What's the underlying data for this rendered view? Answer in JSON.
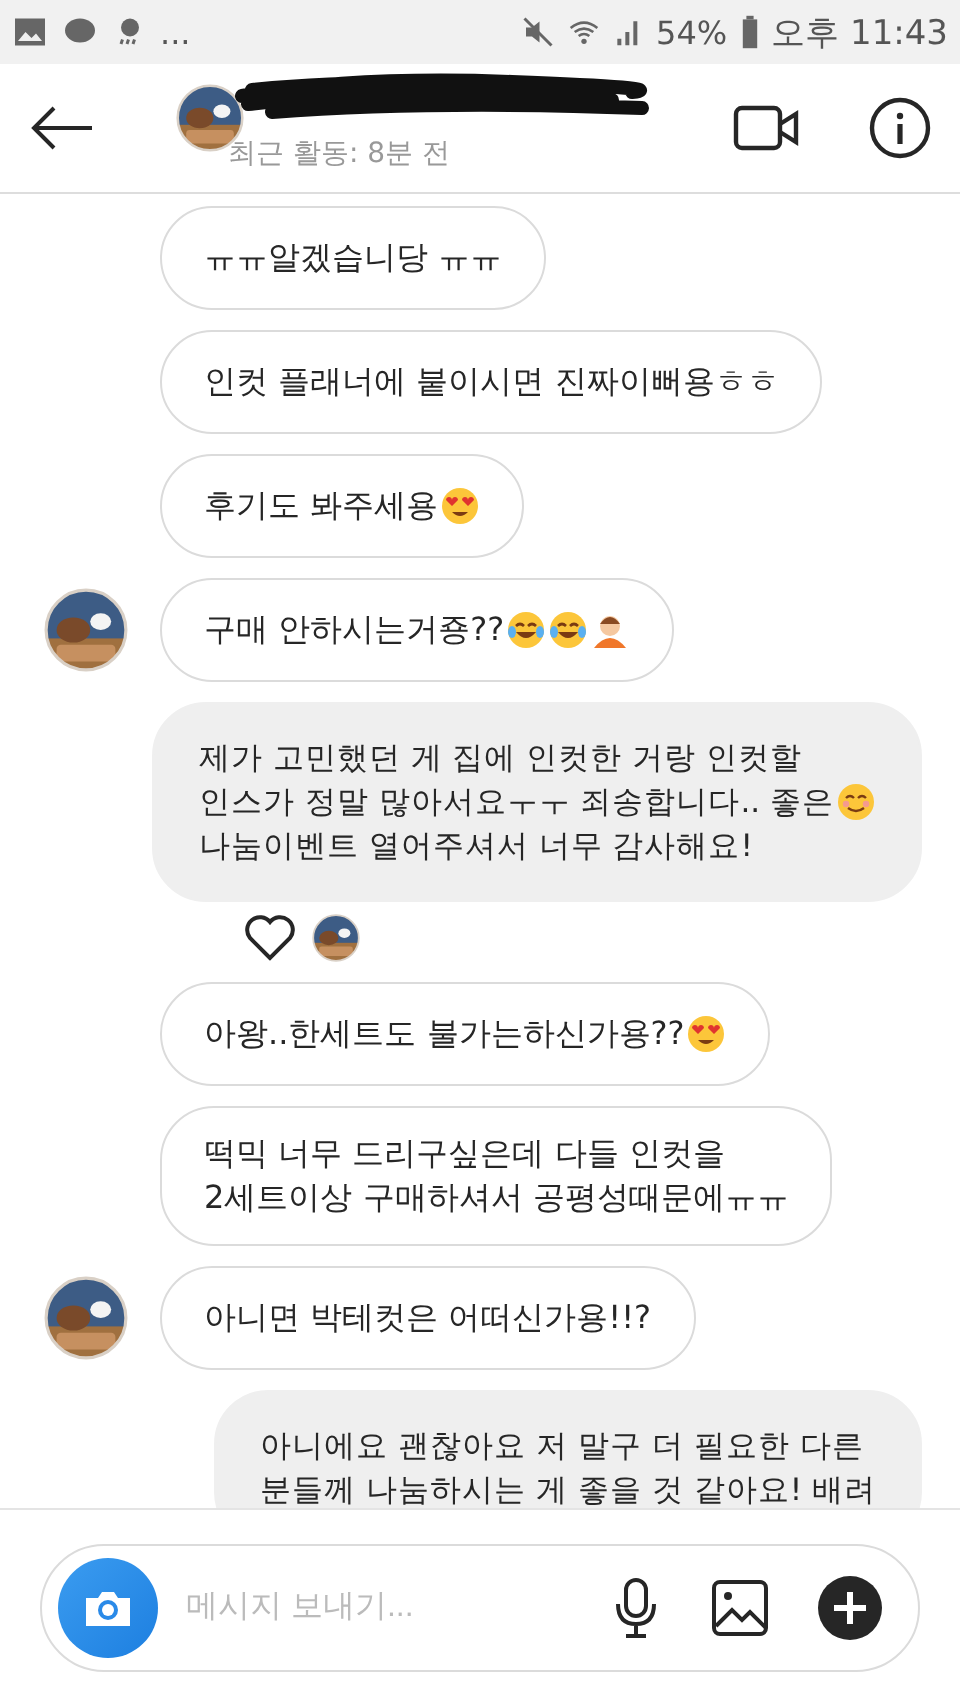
{
  "status_bar": {
    "more": "...",
    "battery": "54%",
    "time": "오후 11:43"
  },
  "header": {
    "last_active": "최근 활동: 8분 전",
    "name_redacted": true
  },
  "messages": [
    {
      "kind": "received",
      "avatar": false,
      "lines": [
        "ㅠㅠ알겠습니당 ㅠㅠ"
      ]
    },
    {
      "kind": "received",
      "avatar": false,
      "lines": [
        "인컷 플래너에 붙이시면 진짜이뻐용ㅎㅎ"
      ]
    },
    {
      "kind": "received",
      "avatar": false,
      "lines": [
        "후기도 봐주세용"
      ],
      "emoji_icons": [
        {
          "kind": "heart-eyes"
        }
      ]
    },
    {
      "kind": "received",
      "avatar": true,
      "lines": [
        "구매 안하시는거죵??"
      ],
      "emoji_icons": [
        {
          "kind": "laugh-cry"
        },
        {
          "kind": "laugh-cry"
        },
        {
          "kind": "bowing"
        }
      ]
    },
    {
      "kind": "sent",
      "lines": [
        "제가 고민했던 게 집에 인컷한 거랑 인컷할",
        "인스가 정말 많아서요ㅜㅜ 죄송합니다.. 좋은",
        "나눔이벤트 열어주셔서 너무 감사해요!"
      ],
      "emoji_icons": [
        {
          "kind": "smile"
        }
      ],
      "reaction": {
        "liked": false
      }
    },
    {
      "kind": "received",
      "avatar": false,
      "lines": [
        "아왕..한세트도 불가는하신가용??"
      ],
      "emoji_icons": [
        {
          "kind": "heart-eyes"
        }
      ]
    },
    {
      "kind": "received",
      "avatar": false,
      "lines": [
        "떡믹 너무 드리구싶은데 다들 인컷을",
        "2세트이상 구매하셔서 공평성때문에ㅠㅠ"
      ]
    },
    {
      "kind": "received",
      "avatar": true,
      "lines": [
        "아니면 박테컷은 어떠신가용!!?"
      ]
    },
    {
      "kind": "sent",
      "lines": [
        "아니에요 괜찮아요 저 말구 더 필요한 다른",
        "분들께 나눔하시는 게 좋을 것 같아요! 배려"
      ]
    }
  ],
  "composer": {
    "placeholder": "메시지 보내기..."
  }
}
